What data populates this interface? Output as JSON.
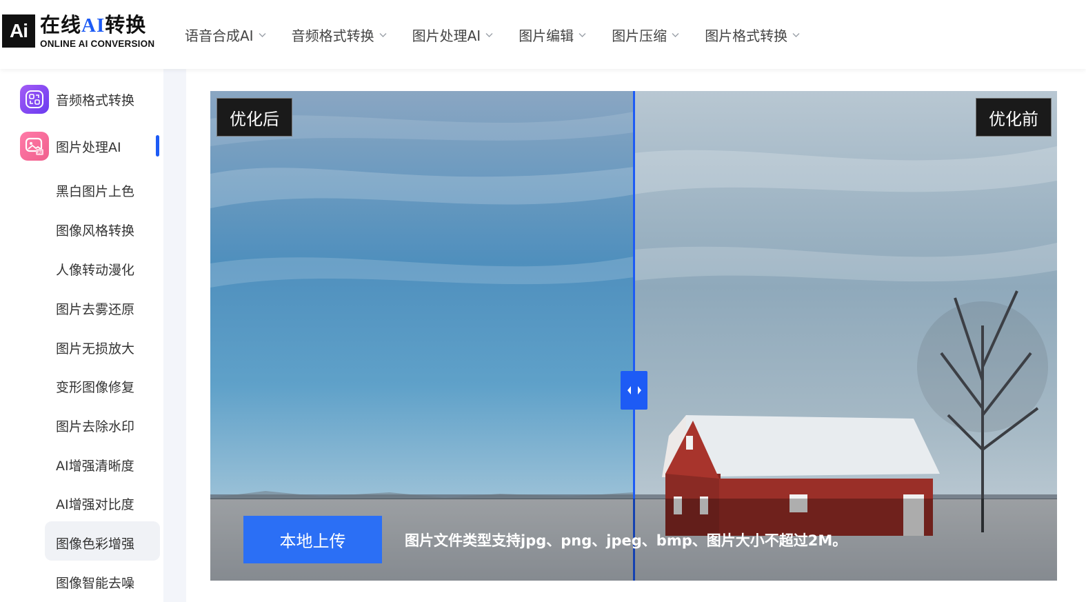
{
  "brand": {
    "mark": "Ai",
    "title_prefix": "在线",
    "title_ai": "AI",
    "title_suffix": "转换",
    "subtitle": "ONLINE AI CONVERSION"
  },
  "nav": {
    "items": [
      {
        "label": "语音合成AI"
      },
      {
        "label": "音频格式转换"
      },
      {
        "label": "图片处理AI"
      },
      {
        "label": "图片编辑"
      },
      {
        "label": "图片压缩"
      },
      {
        "label": "图片格式转换"
      }
    ]
  },
  "sidebar": {
    "categories": [
      {
        "label": "音频格式转换",
        "icon": "audio-convert-icon"
      },
      {
        "label": "图片处理AI",
        "icon": "image-ai-icon",
        "active": true
      }
    ],
    "items": [
      {
        "label": "黑白图片上色"
      },
      {
        "label": "图像风格转换"
      },
      {
        "label": "人像转动漫化"
      },
      {
        "label": "图片去雾还原"
      },
      {
        "label": "图片无损放大"
      },
      {
        "label": "变形图像修复"
      },
      {
        "label": "图片去除水印"
      },
      {
        "label": "AI增强清晰度"
      },
      {
        "label": "AI增强对比度"
      },
      {
        "label": "图像色彩增强",
        "active": true
      },
      {
        "label": "图像智能去噪"
      }
    ]
  },
  "compare": {
    "after_label": "优化后",
    "before_label": "优化前",
    "slider_position": 0.5
  },
  "upload": {
    "button_label": "本地上传",
    "tip": "图片文件类型支持jpg、png、jpeg、bmp、图片大小不超过2M。"
  },
  "colors": {
    "accent": "#1d5bf5",
    "upload_button": "#2b6ff5",
    "sidebar_bg": "#f3f5fa"
  }
}
